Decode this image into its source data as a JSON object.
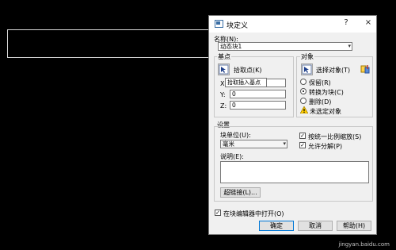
{
  "window": {
    "title": "块定义",
    "help": "?",
    "close": "×"
  },
  "name": {
    "label": "名称(N):",
    "value": "动态块1"
  },
  "base_point": {
    "group_label": "基点",
    "pick_label": "拾取点(K)",
    "tooltip": "拾取插入基点",
    "x_label": "X:",
    "x_value": "",
    "y_label": "Y:",
    "y_value": "0",
    "z_label": "Z:",
    "z_value": "0"
  },
  "objects": {
    "group_label": "对象",
    "select_label": "选择对象(T)",
    "retain": "保留(R)",
    "convert": "转换为块(C)",
    "delete": "删除(D)",
    "status": "未选定对象",
    "selected_option": "convert"
  },
  "settings": {
    "group_label": "设置",
    "unit_label": "块单位(U):",
    "unit_value": "毫米",
    "scale_uniform": "按统一比例缩放(S)",
    "scale_uniform_checked": true,
    "allow_explode": "允许分解(P)",
    "allow_explode_checked": true,
    "desc_label": "说明(E):",
    "hyperlink_button": "超链接(L)..."
  },
  "open_in_editor": {
    "label": "在块编辑器中打开(O)",
    "checked": true
  },
  "buttons": {
    "ok": "确定",
    "cancel": "取消",
    "help": "帮助(H)"
  },
  "watermark": "jingyan.baidu.com"
}
